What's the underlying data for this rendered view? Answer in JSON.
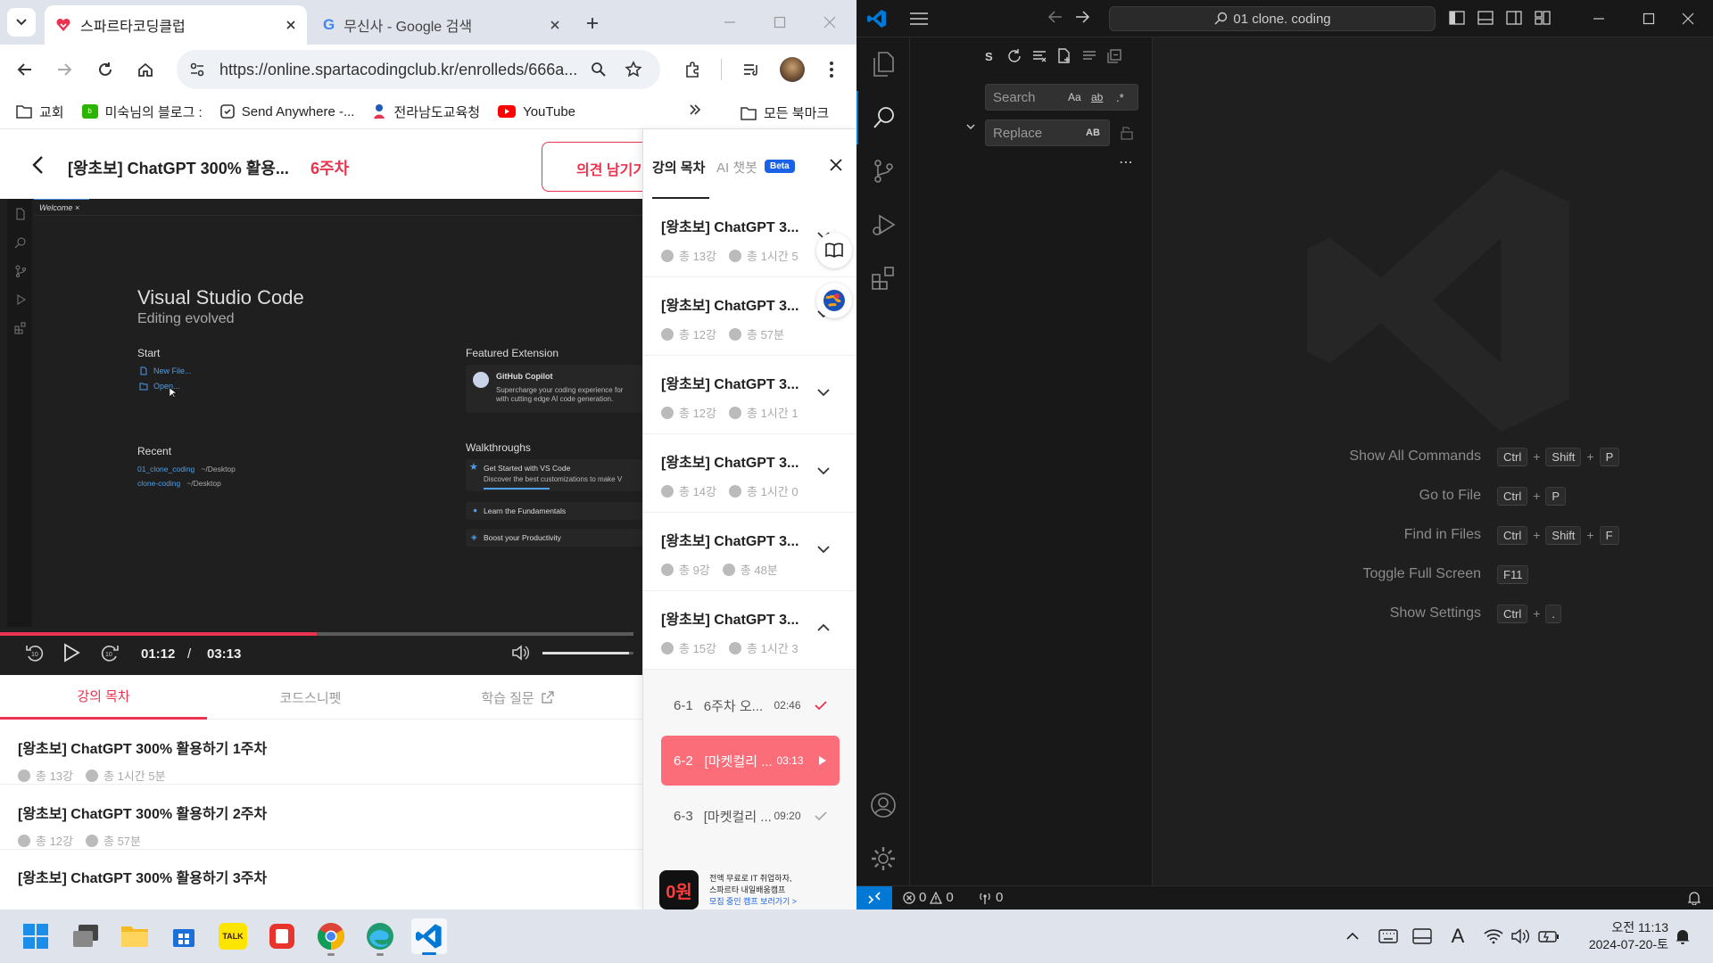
{
  "chrome": {
    "tabs": [
      {
        "title": "스파르타코딩클럽",
        "active": true
      },
      {
        "title": "무신사 - Google 검색",
        "active": false
      }
    ],
    "url": "https://online.spartacodingclub.kr/enrolleds/666a...",
    "bookmarks": [
      {
        "label": "교회",
        "icon": "folder-icon"
      },
      {
        "label": "미숙님의 블로그 :",
        "icon": "blog-icon"
      },
      {
        "label": "Send Anywhere -...",
        "icon": "send-anywhere-icon"
      },
      {
        "label": "전라남도교육청",
        "icon": "education-office-icon"
      },
      {
        "label": "YouTube",
        "icon": "youtube-icon"
      }
    ],
    "all_bookmarks": "모든 북마크"
  },
  "course": {
    "title": "[왕초보] ChatGPT 300% 활용...",
    "week": "6주차",
    "feedback_button": "의견 남기기",
    "video": {
      "welcome_tab": "Welcome",
      "app_title": "Visual Studio Code",
      "app_subtitle": "Editing evolved",
      "start_heading": "Start",
      "start_links": [
        "New File...",
        "Open..."
      ],
      "recent_heading": "Recent",
      "recent": [
        {
          "name": "01_clone_coding",
          "path": "~/Desktop"
        },
        {
          "name": "clone-coding",
          "path": "~/Desktop"
        }
      ],
      "featured_heading": "Featured Extension",
      "featured_name": "GitHub Copilot",
      "featured_desc_1": "Supercharge your coding experience for",
      "featured_desc_2": "with cutting edge AI code generation.",
      "walkthrough_heading": "Walkthroughs",
      "walkthroughs": [
        {
          "title": "Get Started with VS Code",
          "desc": "Discover the best customizations to make V"
        },
        {
          "title": "Learn the Fundamentals"
        },
        {
          "title": "Boost your Productivity"
        }
      ],
      "current_time": "01:12",
      "separator": "/",
      "total_time": "03:13",
      "progress": 0.5,
      "volume": 0.95
    },
    "bottom_tabs": [
      "강의 목차",
      "코드스니펫",
      "학습 질문"
    ],
    "weeks": [
      {
        "title": "[왕초보] ChatGPT 300% 활용하기 1주차",
        "lectures": "총 13강",
        "duration": "총 1시간 5분"
      },
      {
        "title": "[왕초보] ChatGPT 300% 활용하기 2주차",
        "lectures": "총 12강",
        "duration": "총 57분"
      },
      {
        "title": "[왕초보] ChatGPT 300% 활용하기 3주차"
      }
    ]
  },
  "panel": {
    "tab_toc": "강의 목차",
    "tab_ai": "AI 챗봇",
    "beta": "Beta",
    "sections": [
      {
        "title": "[왕초보] ChatGPT 3...",
        "lectures": "총 13강",
        "duration": "총 1시간 5",
        "expanded": false
      },
      {
        "title": "[왕초보] ChatGPT 3...",
        "lectures": "총 12강",
        "duration": "총 57분",
        "expanded": false
      },
      {
        "title": "[왕초보] ChatGPT 3...",
        "lectures": "총 12강",
        "duration": "총 1시간 1",
        "expanded": false
      },
      {
        "title": "[왕초보] ChatGPT 3...",
        "lectures": "총 14강",
        "duration": "총 1시간 0",
        "expanded": false
      },
      {
        "title": "[왕초보] ChatGPT 3...",
        "lectures": "총 9강",
        "duration": "총 48분",
        "expanded": false
      },
      {
        "title": "[왕초보] ChatGPT 3...",
        "lectures": "총 15강",
        "duration": "총 1시간 3",
        "expanded": true
      }
    ],
    "lessons": [
      {
        "num": "6-1",
        "title": "6주차 오...",
        "time": "02:46",
        "state": "done"
      },
      {
        "num": "6-2",
        "title": "[마켓컬리 ...",
        "time": "03:13",
        "state": "playing"
      },
      {
        "num": "6-3",
        "title": "[마켓컬리 ...",
        "time": "09:20",
        "state": "done"
      }
    ],
    "ad": {
      "badge": "0원",
      "line1": "전액 무료로 IT 취업하자,",
      "line2": "스파르타 내일배움캠프",
      "link": "모집 중인 캠프 보러가기 >"
    }
  },
  "vscode": {
    "command_center": "01 clone. coding",
    "search": {
      "label": "S",
      "placeholder": "Search",
      "replace_placeholder": "Replace",
      "case": "Aa",
      "word": "ab",
      "preserve": "AB"
    },
    "shortcuts": [
      {
        "label": "Show All Commands",
        "keys": [
          "Ctrl",
          "Shift",
          "P"
        ]
      },
      {
        "label": "Go to File",
        "keys": [
          "Ctrl",
          "P"
        ]
      },
      {
        "label": "Find in Files",
        "keys": [
          "Ctrl",
          "Shift",
          "F"
        ]
      },
      {
        "label": "Toggle Full Screen",
        "keys": [
          "F11"
        ]
      },
      {
        "label": "Show Settings",
        "keys": [
          "Ctrl",
          "."
        ]
      }
    ],
    "plus": "+",
    "status": {
      "errors": "0",
      "warnings": "0",
      "ports": "0"
    }
  },
  "taskbar": {
    "time": "오전 11:13",
    "date": "2024-07-20-토",
    "kakao": "TALK"
  },
  "colors": {
    "accent": "#e8344e",
    "vscode_blue": "#0078d4",
    "highlight": "#fb6d79"
  }
}
